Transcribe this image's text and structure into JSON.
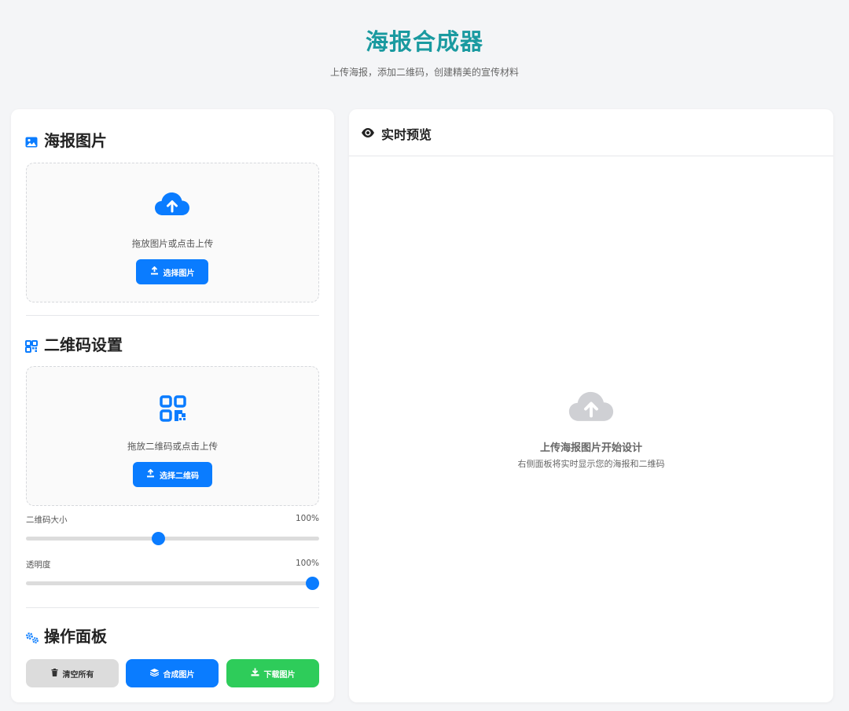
{
  "header": {
    "title": "海报合成器",
    "subtitle": "上传海报，添加二维码，创建精美的宣传材料"
  },
  "poster_section": {
    "title": "海报图片",
    "icon": "image-icon",
    "dropzone_text": "拖放图片或点击上传",
    "button_label": "选择图片"
  },
  "qr_section": {
    "title": "二维码设置",
    "icon": "qrcode-icon",
    "dropzone_text": "拖放二维码或点击上传",
    "button_label": "选择二维码",
    "size_slider": {
      "label": "二维码大小",
      "value_text": "100%",
      "position": 0.45
    },
    "opacity_slider": {
      "label": "透明度",
      "value_text": "100%",
      "position": 1.0
    }
  },
  "actions_section": {
    "title": "操作面板",
    "icon": "cogs-icon",
    "buttons": {
      "clear": "清空所有",
      "compose": "合成图片",
      "download": "下载图片"
    }
  },
  "preview": {
    "title": "实时预览",
    "icon": "eye-icon",
    "placeholder_title": "上传海报图片开始设计",
    "placeholder_sub": "右侧面板将实时显示您的海报和二维码"
  },
  "colors": {
    "accent": "#0a7cff",
    "title": "#1a9aa0",
    "success": "#2ecc5a",
    "neutral": "#dcdcdc"
  }
}
